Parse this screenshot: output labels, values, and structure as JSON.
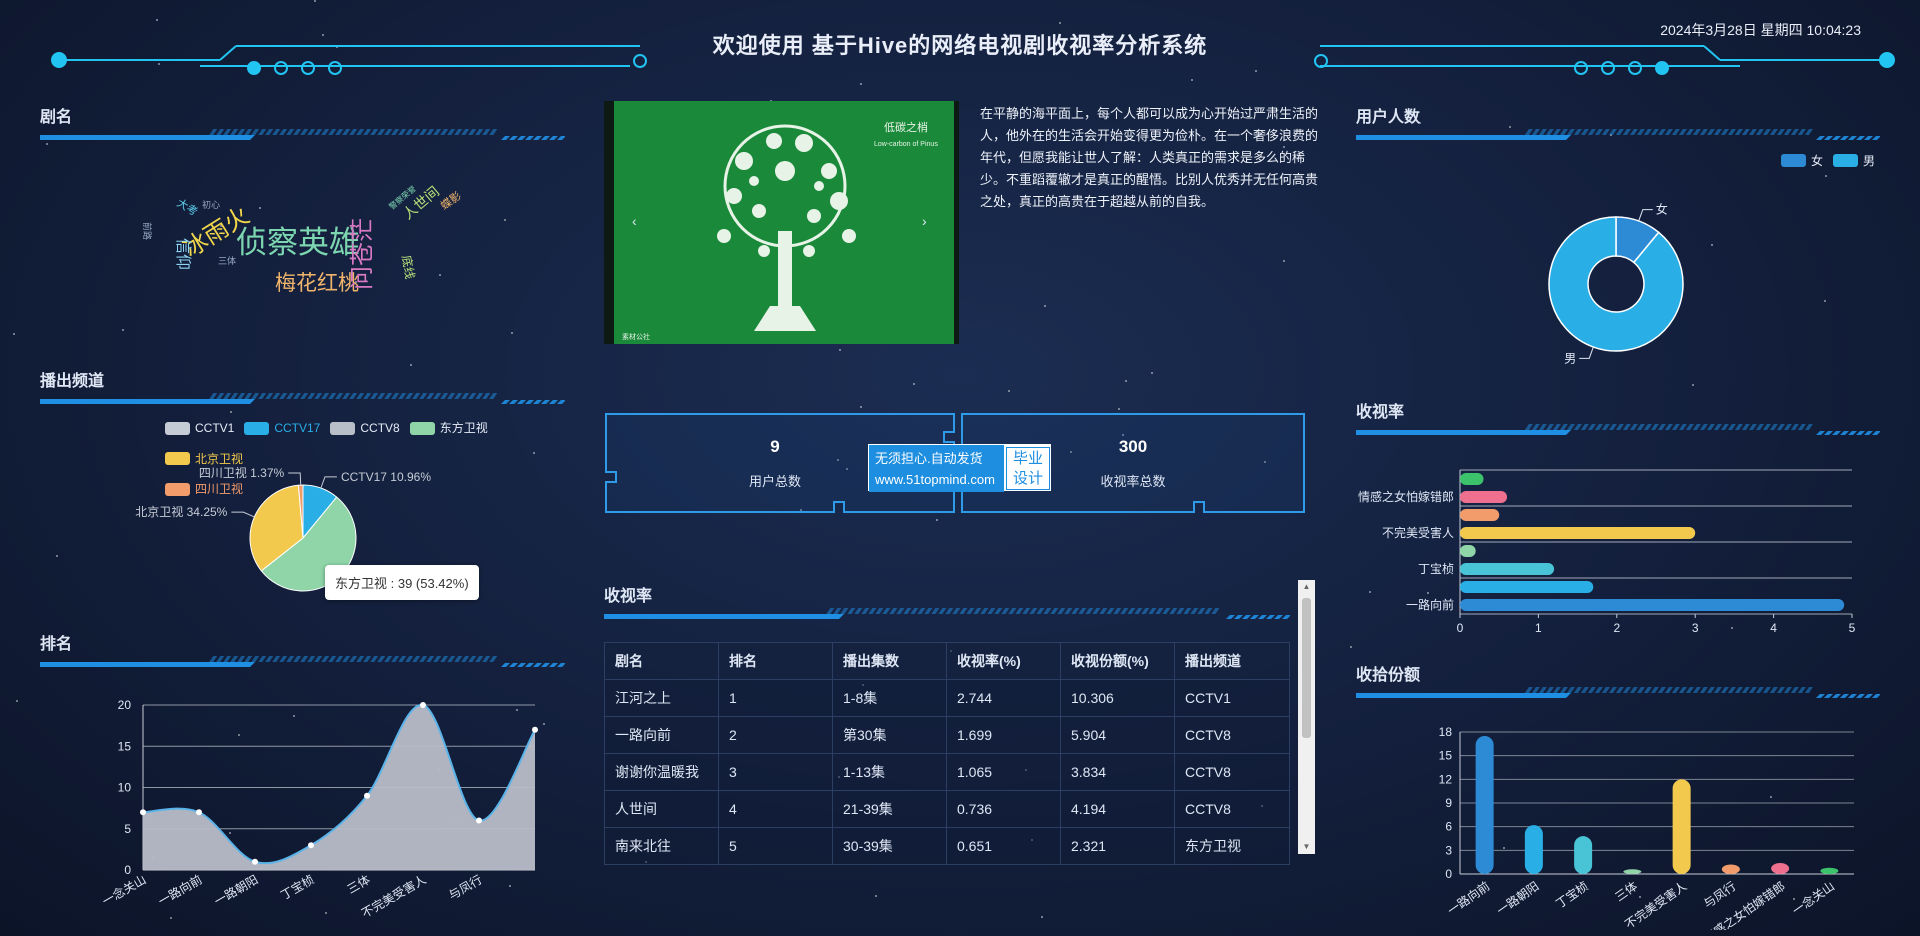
{
  "header": {
    "title": "欢迎使用 基于Hive的网络电视剧收视率分析系统",
    "datetime": "2024年3月28日 星期四 10:04:23"
  },
  "colors": {
    "accent": "#1f8fe3",
    "cyan": "#22c4f2",
    "panel_bg": "#131f3c"
  },
  "panels": {
    "drama_name": "剧名",
    "channel": "播出频道",
    "ranking": "排名",
    "user_count": "用户人数",
    "rating": "收视率",
    "share": "收拾份额",
    "table": "收视率"
  },
  "wordcloud": [
    {
      "text": "侦察英雄",
      "color": "#7cd6b0"
    },
    {
      "text": "梅花红桃",
      "color": "#f0b56b"
    },
    {
      "text": "冰雨火",
      "color": "#f2d74a"
    },
    {
      "text": "问苍茫",
      "color": "#d979c4"
    },
    {
      "text": "信仰",
      "color": "#8fd5f5"
    },
    {
      "text": "人世间",
      "color": "#b8e07a"
    },
    {
      "text": "大考",
      "color": "#5dcdea"
    },
    {
      "text": "蝶影",
      "color": "#f0b56b"
    },
    {
      "text": "底线",
      "color": "#b8e07a"
    },
    {
      "text": "三体",
      "color": "#9aa8c4"
    },
    {
      "text": "初心",
      "color": "#9aa8c4"
    },
    {
      "text": "前路",
      "color": "#9aa8c4"
    },
    {
      "text": "警察荣誉",
      "color": "#7cd6b0"
    },
    {
      "text": "漫长的季节",
      "color": "#9aa8c4"
    }
  ],
  "carousel": {
    "image_title": "低碳之梢",
    "image_subtitle": "Low-carbon of Pinus",
    "image_caption": "素材公社",
    "prev_icon": "chevron-left-icon",
    "next_icon": "chevron-right-icon"
  },
  "paragraph": "在平静的海平面上，每个人都可以成为心开始过严肃生活的人，他外在的生活会开始变得更为俭朴。在一个奢侈浪费的年代，但愿我能让世人了解：人类真正的需求是多么的稀少。不重蹈覆辙才是真正的醒悟。比别人优秀并无任何高贵之处，真正的高贵在于超越从前的自我。",
  "stats": {
    "users": {
      "value": "9",
      "label": "用户总数"
    },
    "ratings": {
      "value": "300",
      "label": "收视率总数"
    }
  },
  "watermark": {
    "line1": "无须担心.自动发货",
    "line2": "www.51topmind.com",
    "badge1": "毕业",
    "badge2": "设计"
  },
  "table": {
    "headers": [
      "剧名",
      "排名",
      "播出集数",
      "收视率(%)",
      "收视份额(%)",
      "播出频道"
    ],
    "rows": [
      [
        "江河之上",
        "1",
        "1-8集",
        "2.744",
        "10.306",
        "CCTV1"
      ],
      [
        "一路向前",
        "2",
        "第30集",
        "1.699",
        "5.904",
        "CCTV8"
      ],
      [
        "谢谢你温暖我",
        "3",
        "1-13集",
        "1.065",
        "3.834",
        "CCTV8"
      ],
      [
        "人世间",
        "4",
        "21-39集",
        "0.736",
        "4.194",
        "CCTV8"
      ],
      [
        "南来北往",
        "5",
        "30-39集",
        "0.651",
        "2.321",
        "东方卫视"
      ]
    ]
  },
  "tooltip": "东方卫视 : 39 (53.42%)",
  "chart_data": [
    {
      "type": "pie",
      "title": "播出频道",
      "legend": [
        "CCTV1",
        "CCTV17",
        "CCTV8",
        "东方卫视",
        "北京卫视",
        "四川卫视"
      ],
      "legend_colors": [
        "#c6ccd6",
        "#2aaee6",
        "#b9bfc9",
        "#8fd5a8",
        "#f2c94c",
        "#f29b6b"
      ],
      "slices": [
        {
          "name": "CCTV17",
          "value": 10.96,
          "label": "CCTV17 10.96%",
          "color": "#2aaee6"
        },
        {
          "name": "东方卫视",
          "value": 53.42,
          "label": "",
          "color": "#8fd5a8"
        },
        {
          "name": "北京卫视",
          "value": 34.25,
          "label": "北京卫视 34.25%",
          "color": "#f2c94c"
        },
        {
          "name": "四川卫视",
          "value": 1.37,
          "label": "四川卫视 1.37%",
          "color": "#f29b6b"
        }
      ]
    },
    {
      "type": "area",
      "title": "排名",
      "categories": [
        "一念关山",
        "一路向前",
        "一路朝阳",
        "丁宝桢",
        "三体",
        "不完美受害人",
        "与凤行"
      ],
      "x": [
        0,
        1,
        2,
        3,
        4,
        5,
        6,
        7
      ],
      "values": [
        7,
        7,
        1,
        3,
        9,
        20,
        6,
        17
      ],
      "ylim": [
        0,
        20
      ],
      "yticks": [
        0,
        5,
        10,
        15,
        20
      ]
    },
    {
      "type": "pie",
      "title": "用户人数",
      "legend": [
        "女",
        "男"
      ],
      "slices": [
        {
          "name": "女",
          "value": 11,
          "color": "#2d8bd6"
        },
        {
          "name": "男",
          "value": 89,
          "color": "#2aaee6"
        }
      ]
    },
    {
      "type": "bar",
      "orientation": "horizontal",
      "title": "收视率",
      "category_labels": [
        "一路向前",
        "丁宝桢",
        "不完美受害人",
        "情感之女怕嫁错郎"
      ],
      "bars": [
        {
          "value": 4.9,
          "color": "#2d8bd6"
        },
        {
          "value": 1.7,
          "color": "#2aaee6"
        },
        {
          "value": 1.2,
          "color": "#49c4d6"
        },
        {
          "value": 0.2,
          "color": "#8fd5a8"
        },
        {
          "value": 3.0,
          "color": "#f2c94c"
        },
        {
          "value": 0.5,
          "color": "#f29b6b"
        },
        {
          "value": 0.6,
          "color": "#ef6f8f"
        },
        {
          "value": 0.3,
          "color": "#3cc26b"
        }
      ],
      "xlim": [
        0,
        5
      ],
      "xticks": [
        0,
        1,
        2,
        3,
        4,
        5
      ]
    },
    {
      "type": "bar",
      "title": "收拾份额",
      "categories": [
        "一路向前",
        "一路朝阳",
        "丁宝桢",
        "三体",
        "不完美受害人",
        "与凤行",
        "情感之女怕嫁错郎",
        "一念关山"
      ],
      "values": [
        17.5,
        6.2,
        4.8,
        0.6,
        12,
        1.2,
        1.4,
        0.8
      ],
      "colors": [
        "#2d8bd6",
        "#2aaee6",
        "#49c4d6",
        "#8fd5a8",
        "#f2c94c",
        "#f29b6b",
        "#ef6f8f",
        "#3cc26b"
      ],
      "ylim": [
        0,
        18
      ],
      "yticks": [
        0,
        3,
        6,
        9,
        12,
        15,
        18
      ]
    }
  ]
}
